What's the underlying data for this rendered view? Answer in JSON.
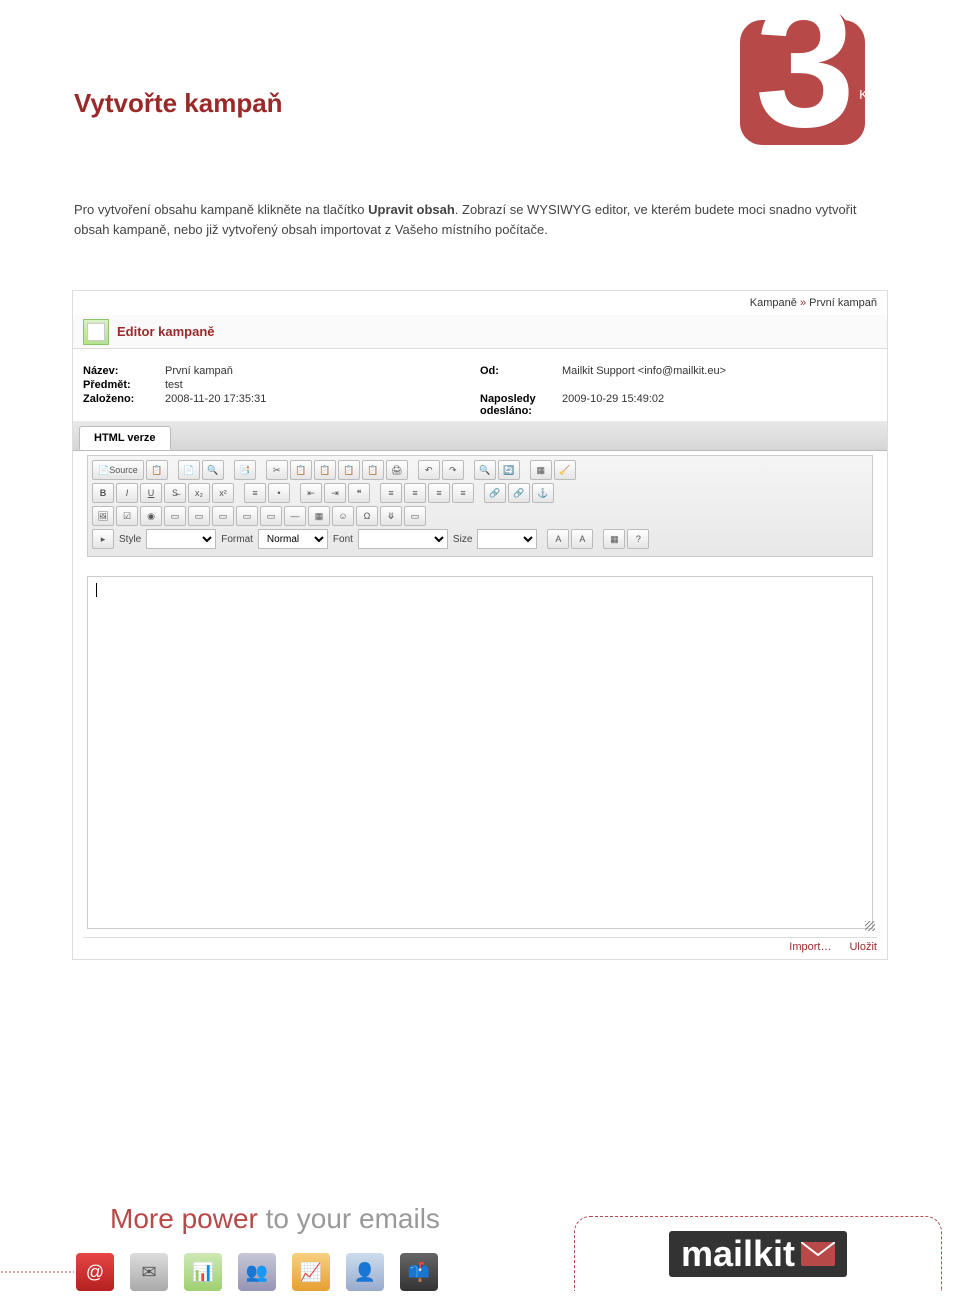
{
  "page": {
    "title": "Vytvořte kampaň",
    "step_number": "3",
    "step_label": "KROK",
    "intro_1": "Pro vytvoření obsahu kampaně klikněte na tlačítko ",
    "intro_bold": "Upravit obsah",
    "intro_2": ". Zobrazí se WYSIWYG editor, ve kterém budete moci snadno vytvořit obsah kampaně, nebo již vytvořený obsah importovat z Vašeho místního počítače."
  },
  "screenshot": {
    "breadcrumb_1": "Kampaně",
    "breadcrumb_sep": " » ",
    "breadcrumb_2": "První kampaň",
    "editor_title": "Editor kampaně",
    "info": {
      "nazev_label": "Název:",
      "nazev_value": "První kampaň",
      "predmet_label": "Předmět:",
      "predmet_value": "test",
      "zalozeno_label": "Založeno:",
      "zalozeno_value": "2008-11-20 17:35:31",
      "od_label": "Od:",
      "od_value": "Mailkit Support <info@mailkit.eu>",
      "naposledy_label": "Naposledy odesláno:",
      "naposledy_value": "2009-10-29 15:49:02"
    },
    "tab": "HTML verze",
    "toolbar": {
      "source": "Source",
      "style_label": "Style",
      "format_label": "Format",
      "format_value": "Normal",
      "font_label": "Font",
      "size_label": "Size"
    },
    "footer": {
      "import": "Import…",
      "save": "Uložit"
    }
  },
  "footer": {
    "tagline_1": "More power ",
    "tagline_2": "to your emails",
    "logo": "mailkit"
  }
}
